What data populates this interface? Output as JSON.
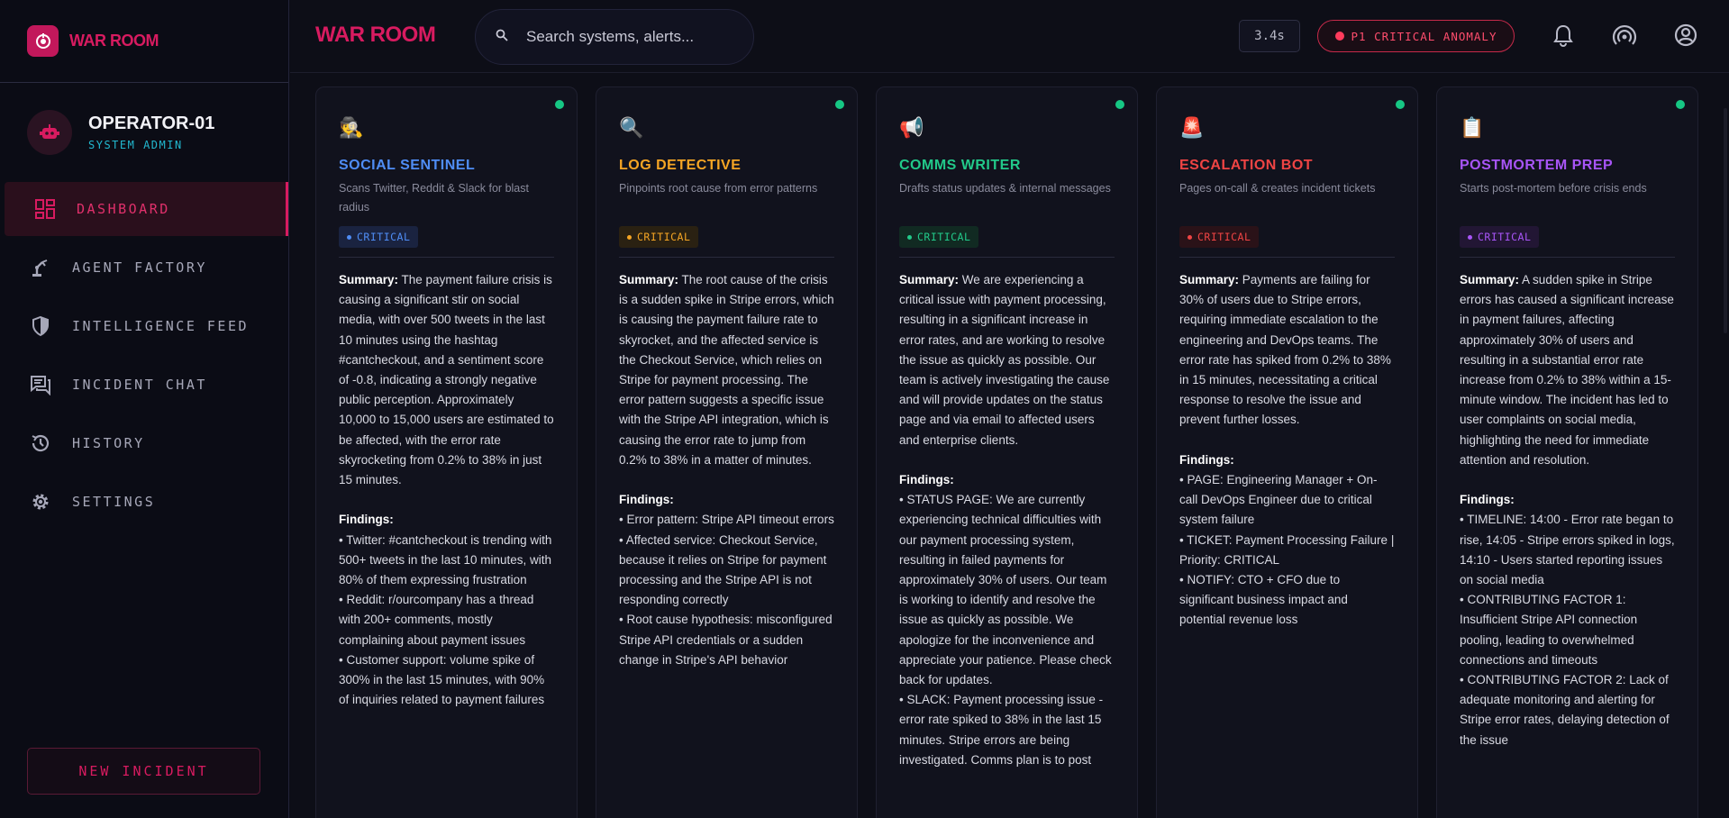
{
  "app": {
    "brand": "WAR ROOM"
  },
  "header": {
    "brand": "WAR ROOM",
    "search_placeholder": "Search systems, alerts...",
    "timer": "3.4s",
    "alert": "P1 CRITICAL ANOMALY"
  },
  "operator": {
    "name": "OPERATOR-01",
    "role": "SYSTEM ADMIN"
  },
  "nav": [
    {
      "label": "DASHBOARD",
      "icon": "dashboard-icon",
      "active": true
    },
    {
      "label": "AGENT FACTORY",
      "icon": "robot-arm-icon"
    },
    {
      "label": "INTELLIGENCE FEED",
      "icon": "shield-icon"
    },
    {
      "label": "INCIDENT CHAT",
      "icon": "chat-icon"
    },
    {
      "label": "HISTORY",
      "icon": "history-icon"
    },
    {
      "label": "SETTINGS",
      "icon": "gear-icon"
    }
  ],
  "new_incident": "NEW INCIDENT",
  "agents": [
    {
      "emoji": "🕵️",
      "title": "SOCIAL SENTINEL",
      "color": "#4f8df5",
      "badge_bg": "#1a2340",
      "desc": "Scans Twitter, Reddit & Slack for blast radius",
      "badge": "CRITICAL",
      "summary_label": "Summary:",
      "summary": "The payment failure crisis is causing a significant stir on social media, with over 500 tweets in the last 10 minutes using the hashtag #cantcheckout, and a sentiment score of -0.8, indicating a strongly negative public perception. Approximately 10,000 to 15,000 users are estimated to be affected, with the error rate skyrocketing from 0.2% to 38% in just 15 minutes.",
      "findings_label": "Findings:",
      "findings": "• Twitter: #cantcheckout is trending with 500+ tweets in the last 10 minutes, with 80% of them expressing frustration\n• Reddit: r/ourcompany has a thread with 200+ comments, mostly complaining about payment issues\n• Customer support: volume spike of 300% in the last 15 minutes, with 90% of inquiries related to payment failures"
    },
    {
      "emoji": "🔍",
      "title": "LOG DETECTIVE",
      "color": "#f5a524",
      "badge_bg": "#2a2112",
      "desc": "Pinpoints root cause from error patterns",
      "badge": "CRITICAL",
      "summary_label": "Summary:",
      "summary": "The root cause of the crisis is a sudden spike in Stripe errors, which is causing the payment failure rate to skyrocket, and the affected service is the Checkout Service, which relies on Stripe for payment processing. The error pattern suggests a specific issue with the Stripe API integration, which is causing the error rate to jump from 0.2% to 38% in a matter of minutes.",
      "findings_label": "Findings:",
      "findings": "• Error pattern: Stripe API timeout errors\n• Affected service: Checkout Service, because it relies on Stripe for payment processing and the Stripe API is not responding correctly\n• Root cause hypothesis: misconfigured Stripe API credentials or a sudden change in Stripe's API behavior"
    },
    {
      "emoji": "📢",
      "title": "COMMS WRITER",
      "color": "#22c98a",
      "badge_bg": "#112a22",
      "desc": "Drafts status updates & internal messages",
      "badge": "CRITICAL",
      "summary_label": "Summary:",
      "summary": "We are experiencing a critical issue with payment processing, resulting in a significant increase in error rates, and are working to resolve the issue as quickly as possible. Our team is actively investigating the cause and will provide updates on the status page and via email to affected users and enterprise clients.",
      "findings_label": "Findings:",
      "findings": "• STATUS PAGE: We are currently experiencing technical difficulties with our payment processing system, resulting in failed payments for approximately 30% of users. Our team is working to identify and resolve the issue as quickly as possible. We apologize for the inconvenience and appreciate your patience. Please check back for updates.\n• SLACK: Payment processing issue - error rate spiked to 38% in the last 15 minutes. Stripe errors are being investigated. Comms plan is to post"
    },
    {
      "emoji": "🚨",
      "title": "ESCALATION BOT",
      "color": "#ef4444",
      "badge_bg": "#2a1218",
      "desc": "Pages on-call & creates incident tickets",
      "badge": "CRITICAL",
      "summary_label": "Summary:",
      "summary": "Payments are failing for 30% of users due to Stripe errors, requiring immediate escalation to the engineering and DevOps teams. The error rate has spiked from 0.2% to 38% in 15 minutes, necessitating a critical response to resolve the issue and prevent further losses.",
      "findings_label": "Findings:",
      "findings": "• PAGE: Engineering Manager + On-call DevOps Engineer due to critical system failure\n• TICKET: Payment Processing Failure | Priority: CRITICAL\n• NOTIFY: CTO + CFO due to significant business impact and potential revenue loss"
    },
    {
      "emoji": "📋",
      "title": "POSTMORTEM PREP",
      "color": "#a855f7",
      "badge_bg": "#221634",
      "desc": "Starts post-mortem before crisis ends",
      "badge": "CRITICAL",
      "summary_label": "Summary:",
      "summary": "A sudden spike in Stripe errors has caused a significant increase in payment failures, affecting approximately 30% of users and resulting in a substantial error rate increase from 0.2% to 38% within a 15-minute window. The incident has led to user complaints on social media, highlighting the need for immediate attention and resolution.",
      "findings_label": "Findings:",
      "findings": "• TIMELINE: 14:00 - Error rate began to rise, 14:05 - Stripe errors spiked in logs, 14:10 - Users started reporting issues on social media\n• CONTRIBUTING FACTOR 1: Insufficient Stripe API connection pooling, leading to overwhelmed connections and timeouts\n• CONTRIBUTING FACTOR 2: Lack of adequate monitoring and alerting for Stripe error rates, delaying detection of the issue"
    }
  ]
}
